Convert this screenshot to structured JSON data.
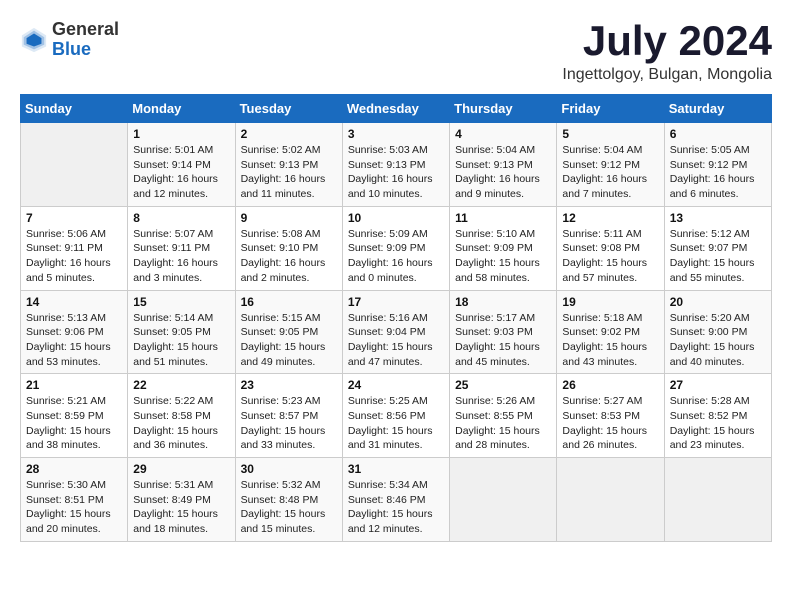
{
  "header": {
    "logo_general": "General",
    "logo_blue": "Blue",
    "month_year": "July 2024",
    "location": "Ingettolgoy, Bulgan, Mongolia"
  },
  "weekdays": [
    "Sunday",
    "Monday",
    "Tuesday",
    "Wednesday",
    "Thursday",
    "Friday",
    "Saturday"
  ],
  "weeks": [
    [
      {
        "day": "",
        "sunrise": "",
        "sunset": "",
        "daylight": ""
      },
      {
        "day": "1",
        "sunrise": "Sunrise: 5:01 AM",
        "sunset": "Sunset: 9:14 PM",
        "daylight": "Daylight: 16 hours and 12 minutes."
      },
      {
        "day": "2",
        "sunrise": "Sunrise: 5:02 AM",
        "sunset": "Sunset: 9:13 PM",
        "daylight": "Daylight: 16 hours and 11 minutes."
      },
      {
        "day": "3",
        "sunrise": "Sunrise: 5:03 AM",
        "sunset": "Sunset: 9:13 PM",
        "daylight": "Daylight: 16 hours and 10 minutes."
      },
      {
        "day": "4",
        "sunrise": "Sunrise: 5:04 AM",
        "sunset": "Sunset: 9:13 PM",
        "daylight": "Daylight: 16 hours and 9 minutes."
      },
      {
        "day": "5",
        "sunrise": "Sunrise: 5:04 AM",
        "sunset": "Sunset: 9:12 PM",
        "daylight": "Daylight: 16 hours and 7 minutes."
      },
      {
        "day": "6",
        "sunrise": "Sunrise: 5:05 AM",
        "sunset": "Sunset: 9:12 PM",
        "daylight": "Daylight: 16 hours and 6 minutes."
      }
    ],
    [
      {
        "day": "7",
        "sunrise": "Sunrise: 5:06 AM",
        "sunset": "Sunset: 9:11 PM",
        "daylight": "Daylight: 16 hours and 5 minutes."
      },
      {
        "day": "8",
        "sunrise": "Sunrise: 5:07 AM",
        "sunset": "Sunset: 9:11 PM",
        "daylight": "Daylight: 16 hours and 3 minutes."
      },
      {
        "day": "9",
        "sunrise": "Sunrise: 5:08 AM",
        "sunset": "Sunset: 9:10 PM",
        "daylight": "Daylight: 16 hours and 2 minutes."
      },
      {
        "day": "10",
        "sunrise": "Sunrise: 5:09 AM",
        "sunset": "Sunset: 9:09 PM",
        "daylight": "Daylight: 16 hours and 0 minutes."
      },
      {
        "day": "11",
        "sunrise": "Sunrise: 5:10 AM",
        "sunset": "Sunset: 9:09 PM",
        "daylight": "Daylight: 15 hours and 58 minutes."
      },
      {
        "day": "12",
        "sunrise": "Sunrise: 5:11 AM",
        "sunset": "Sunset: 9:08 PM",
        "daylight": "Daylight: 15 hours and 57 minutes."
      },
      {
        "day": "13",
        "sunrise": "Sunrise: 5:12 AM",
        "sunset": "Sunset: 9:07 PM",
        "daylight": "Daylight: 15 hours and 55 minutes."
      }
    ],
    [
      {
        "day": "14",
        "sunrise": "Sunrise: 5:13 AM",
        "sunset": "Sunset: 9:06 PM",
        "daylight": "Daylight: 15 hours and 53 minutes."
      },
      {
        "day": "15",
        "sunrise": "Sunrise: 5:14 AM",
        "sunset": "Sunset: 9:05 PM",
        "daylight": "Daylight: 15 hours and 51 minutes."
      },
      {
        "day": "16",
        "sunrise": "Sunrise: 5:15 AM",
        "sunset": "Sunset: 9:05 PM",
        "daylight": "Daylight: 15 hours and 49 minutes."
      },
      {
        "day": "17",
        "sunrise": "Sunrise: 5:16 AM",
        "sunset": "Sunset: 9:04 PM",
        "daylight": "Daylight: 15 hours and 47 minutes."
      },
      {
        "day": "18",
        "sunrise": "Sunrise: 5:17 AM",
        "sunset": "Sunset: 9:03 PM",
        "daylight": "Daylight: 15 hours and 45 minutes."
      },
      {
        "day": "19",
        "sunrise": "Sunrise: 5:18 AM",
        "sunset": "Sunset: 9:02 PM",
        "daylight": "Daylight: 15 hours and 43 minutes."
      },
      {
        "day": "20",
        "sunrise": "Sunrise: 5:20 AM",
        "sunset": "Sunset: 9:00 PM",
        "daylight": "Daylight: 15 hours and 40 minutes."
      }
    ],
    [
      {
        "day": "21",
        "sunrise": "Sunrise: 5:21 AM",
        "sunset": "Sunset: 8:59 PM",
        "daylight": "Daylight: 15 hours and 38 minutes."
      },
      {
        "day": "22",
        "sunrise": "Sunrise: 5:22 AM",
        "sunset": "Sunset: 8:58 PM",
        "daylight": "Daylight: 15 hours and 36 minutes."
      },
      {
        "day": "23",
        "sunrise": "Sunrise: 5:23 AM",
        "sunset": "Sunset: 8:57 PM",
        "daylight": "Daylight: 15 hours and 33 minutes."
      },
      {
        "day": "24",
        "sunrise": "Sunrise: 5:25 AM",
        "sunset": "Sunset: 8:56 PM",
        "daylight": "Daylight: 15 hours and 31 minutes."
      },
      {
        "day": "25",
        "sunrise": "Sunrise: 5:26 AM",
        "sunset": "Sunset: 8:55 PM",
        "daylight": "Daylight: 15 hours and 28 minutes."
      },
      {
        "day": "26",
        "sunrise": "Sunrise: 5:27 AM",
        "sunset": "Sunset: 8:53 PM",
        "daylight": "Daylight: 15 hours and 26 minutes."
      },
      {
        "day": "27",
        "sunrise": "Sunrise: 5:28 AM",
        "sunset": "Sunset: 8:52 PM",
        "daylight": "Daylight: 15 hours and 23 minutes."
      }
    ],
    [
      {
        "day": "28",
        "sunrise": "Sunrise: 5:30 AM",
        "sunset": "Sunset: 8:51 PM",
        "daylight": "Daylight: 15 hours and 20 minutes."
      },
      {
        "day": "29",
        "sunrise": "Sunrise: 5:31 AM",
        "sunset": "Sunset: 8:49 PM",
        "daylight": "Daylight: 15 hours and 18 minutes."
      },
      {
        "day": "30",
        "sunrise": "Sunrise: 5:32 AM",
        "sunset": "Sunset: 8:48 PM",
        "daylight": "Daylight: 15 hours and 15 minutes."
      },
      {
        "day": "31",
        "sunrise": "Sunrise: 5:34 AM",
        "sunset": "Sunset: 8:46 PM",
        "daylight": "Daylight: 15 hours and 12 minutes."
      },
      {
        "day": "",
        "sunrise": "",
        "sunset": "",
        "daylight": ""
      },
      {
        "day": "",
        "sunrise": "",
        "sunset": "",
        "daylight": ""
      },
      {
        "day": "",
        "sunrise": "",
        "sunset": "",
        "daylight": ""
      }
    ]
  ]
}
